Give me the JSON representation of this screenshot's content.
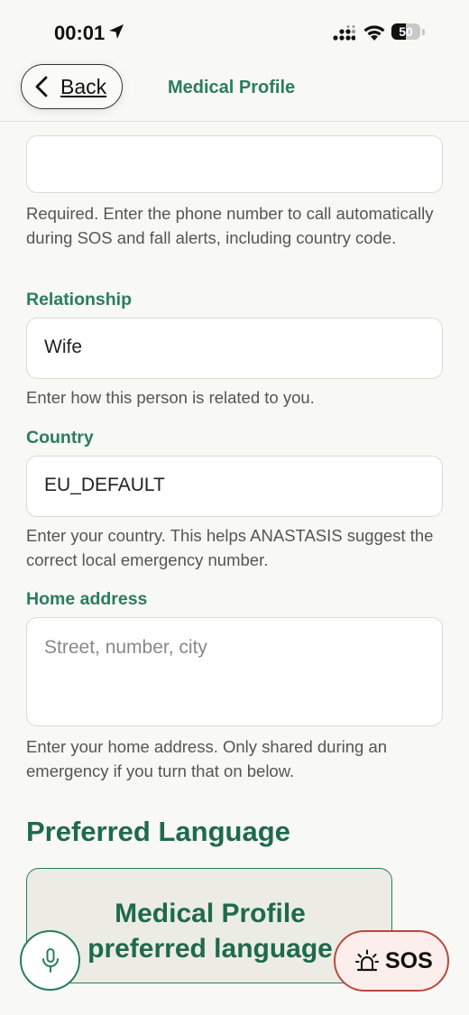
{
  "status_bar": {
    "time": "00:01",
    "battery": "50",
    "battery_level": 0.5,
    "icons": [
      "location-arrow-icon",
      "signal-icon",
      "wifi-icon",
      "battery-icon"
    ]
  },
  "nav": {
    "back_label": "Back",
    "title": "Medical Profile"
  },
  "form": {
    "phone_help": "Required. Enter the phone number to call automatically during SOS and fall alerts, including country code.",
    "relationship": {
      "label": "Relationship",
      "value": "Wife",
      "help": "Enter how this person is related to you."
    },
    "country": {
      "label": "Country",
      "value": "EU_DEFAULT",
      "help": "Enter your country. This helps ANASTASIS suggest the correct local emergency number."
    },
    "home_address": {
      "label": "Home address",
      "placeholder": "Street, number, city",
      "value": "",
      "help": "Enter your home address. Only shared during an emergency if you turn that on below."
    }
  },
  "preferred_language": {
    "section_title": "Preferred Language",
    "card_text_line1": "Medical Profile",
    "card_text_line2": "preferred language"
  },
  "floating": {
    "mic_icon": "microphone-icon",
    "sos_icon": "alarm-light-icon",
    "sos_label": "SOS"
  },
  "colors": {
    "accent_green": "#2a7d5e",
    "dark_green": "#1e6a4c",
    "sos_red": "#b84a3e",
    "background": "#f8f8f5"
  }
}
